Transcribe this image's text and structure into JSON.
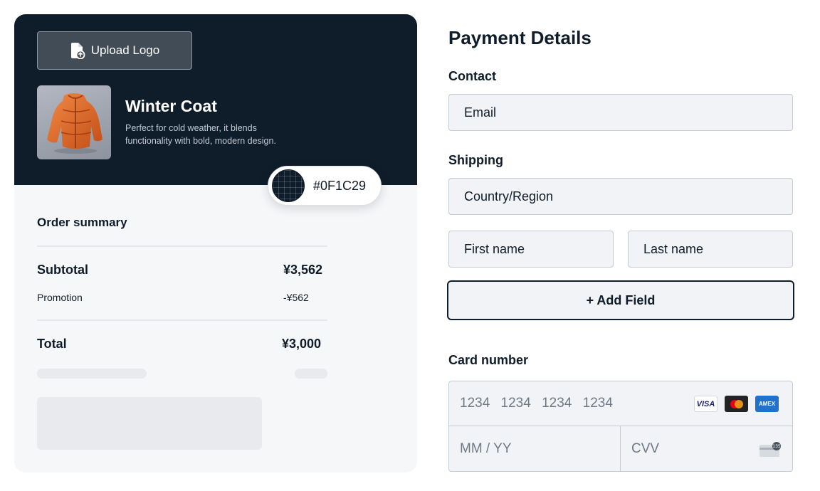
{
  "product": {
    "upload_label": "Upload Logo",
    "title": "Winter Coat",
    "description": "Perfect for cold weather, it blends functionality with bold, modern design.",
    "image_alt": "orange puffer jacket"
  },
  "theme_color": {
    "hex_label": "#0F1C29",
    "value": "#0f1c29"
  },
  "summary": {
    "title": "Order summary",
    "subtotal_label": "Subtotal",
    "subtotal_value": "¥3,562",
    "promotion_label": "Promotion",
    "promotion_value": "-¥562",
    "total_label": "Total",
    "total_value": "¥3,000"
  },
  "form": {
    "title": "Payment Details",
    "contact_label": "Contact",
    "email_placeholder": "Email",
    "shipping_label": "Shipping",
    "country_placeholder": "Country/Region",
    "first_name_placeholder": "First name",
    "last_name_placeholder": "Last name",
    "add_field_label": "+ Add Field",
    "card_label": "Card number",
    "card_number_placeholder": "1234 1234 1234 1234",
    "expiry_placeholder": "MM / YY",
    "cvv_placeholder": "CVV",
    "card_brands": [
      "VISA",
      "mastercard-icon",
      "AMEX"
    ],
    "cvv_hint": "135"
  },
  "colors": {
    "dark": "#0f1c29",
    "field_bg": "#f1f3f6",
    "field_border": "#c3cbd4",
    "product_accent": "#e8672a"
  }
}
